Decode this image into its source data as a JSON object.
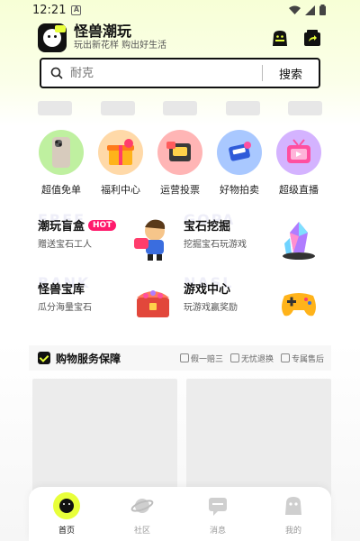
{
  "status_bar": {
    "time": "12:21"
  },
  "header": {
    "title": "怪兽潮玩",
    "subtitle": "玩出新花样 购出好生活"
  },
  "search": {
    "placeholder": "耐克",
    "button_label": "搜索"
  },
  "categories": [
    {
      "label": "超值免单",
      "icon": "phone-product-icon",
      "color": "#bff0a0"
    },
    {
      "label": "福利中心",
      "icon": "gift-box-icon",
      "color": "#ffd9a8"
    },
    {
      "label": "运营投票",
      "icon": "vote-card-icon",
      "color": "#ffb5b5"
    },
    {
      "label": "好物拍卖",
      "icon": "auction-card-icon",
      "color": "#a9c8ff"
    },
    {
      "label": "超级直播",
      "icon": "tv-live-icon",
      "color": "#d4b3ff"
    }
  ],
  "features": [
    {
      "title": "潮玩盲盒",
      "badge": "HOT",
      "subtitle": "赠送宝石工人",
      "icon": "toy-figure-icon",
      "watermark": "FREE"
    },
    {
      "title": "宝石挖掘",
      "subtitle": "挖掘宝石玩游戏",
      "icon": "gem-crystal-icon",
      "watermark": "GOPA"
    },
    {
      "title": "怪兽宝库",
      "subtitle": "瓜分海量宝石",
      "icon": "treasure-chest-icon",
      "watermark": "BANK"
    },
    {
      "title": "游戏中心",
      "subtitle": "玩游戏赢奖励",
      "icon": "gamepad-icon",
      "watermark": "NASL"
    }
  ],
  "guarantee": {
    "title": "购物服务保障",
    "items": [
      "假一赔三",
      "无忧退换",
      "专属售后"
    ]
  },
  "tabbar": [
    {
      "label": "首页",
      "icon": "home-monster-icon",
      "active": true
    },
    {
      "label": "社区",
      "icon": "planet-icon",
      "active": false
    },
    {
      "label": "消息",
      "icon": "message-icon",
      "active": false
    },
    {
      "label": "我的",
      "icon": "profile-icon",
      "active": false
    }
  ],
  "colors": {
    "accent": "#e8ff3a",
    "hot": "#ff1a6c",
    "text": "#111111"
  }
}
